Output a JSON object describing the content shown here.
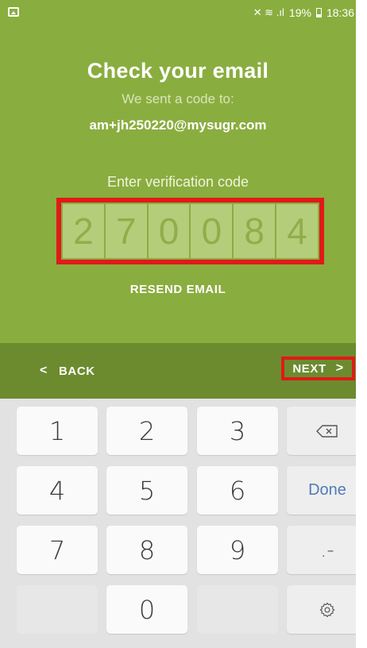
{
  "status_bar": {
    "signal_text": "✕ ☷ .∣",
    "battery": "19%",
    "time": "18:36"
  },
  "main": {
    "title": "Check your email",
    "subtitle": "We sent a code to:",
    "email": "am+jh250220@mysugr.com",
    "enter_label": "Enter verification code",
    "code_digits": [
      "2",
      "7",
      "0",
      "0",
      "8",
      "4"
    ],
    "resend_label": "RESEND EMAIL"
  },
  "nav": {
    "back_label": "BACK",
    "next_label": "NEXT"
  },
  "keyboard": {
    "keys": [
      "1",
      "2",
      "3",
      "4",
      "5",
      "6",
      "7",
      "8",
      "9",
      "0"
    ],
    "done_label": "Done",
    "punct_label": ".-"
  },
  "colors": {
    "background": "#8aad3f",
    "nav_bar": "#6c8b2e",
    "highlight": "#e11919",
    "done_text": "#4f7cb6"
  },
  "icons": {
    "status_left": "gallery-icon",
    "backspace": "backspace-icon",
    "settings": "gear-icon"
  }
}
